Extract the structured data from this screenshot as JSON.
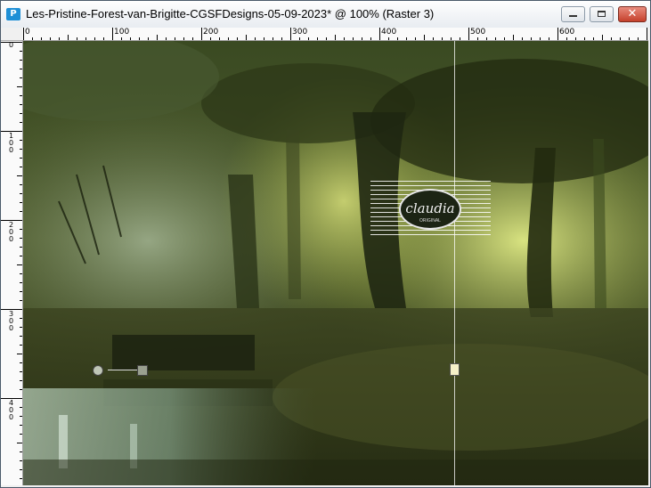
{
  "window": {
    "app_icon": "psp-app-icon",
    "title": "Les-Pristine-Forest-van-Brigitte-CGSFDesigns-05-09-2023* @ 100% (Raster 3)",
    "buttons": {
      "minimize": "minimize-icon",
      "maximize": "maximize-icon",
      "close": "close-icon"
    }
  },
  "ruler_h": {
    "labels": [
      "0",
      "100",
      "200",
      "300",
      "400",
      "500",
      "600"
    ]
  },
  "ruler_v": {
    "labels": [
      "1\n0\n0",
      "2\n0\n0",
      "3\n0\n0",
      "4\n0\n0"
    ]
  },
  "watermark": {
    "name": "claudia",
    "sub": "ORIGINAL"
  },
  "colors": {
    "accent_dark": "#1c2414",
    "forest_glow": "#e8f28a",
    "guide": "#ffffff"
  }
}
